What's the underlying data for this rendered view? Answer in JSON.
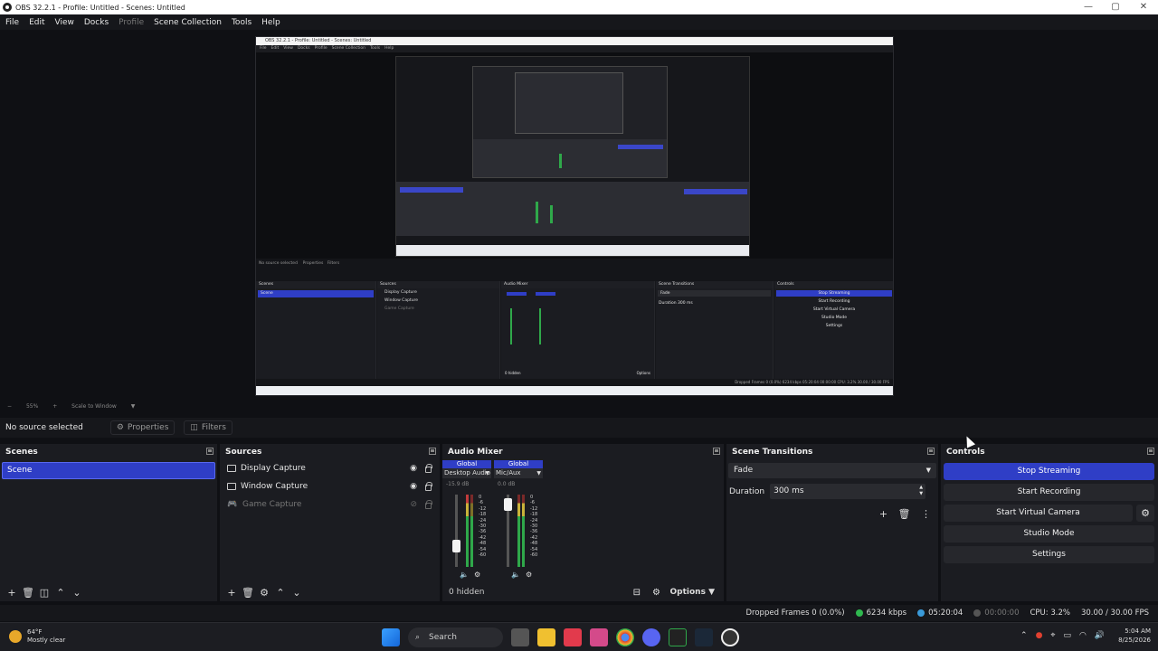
{
  "window": {
    "title": "OBS 32.2.1 - Profile: Untitled - Scenes: Untitled",
    "minimize": "—",
    "maximize": "▢",
    "close": "✕"
  },
  "menu": [
    "File",
    "Edit",
    "View",
    "Docks",
    "Profile",
    "Scene Collection",
    "Tools",
    "Help"
  ],
  "nested_preview": {
    "title": "OBS 32.2.1 - Profile: Untitled - Scenes: Untitled",
    "menu": [
      "File",
      "Edit",
      "View",
      "Docks",
      "Profile",
      "Scene Collection",
      "Tools",
      "Help"
    ],
    "no_source": "No source selected",
    "properties": "Properties",
    "filters": "Filters",
    "scenes": "Scenes",
    "scene": "Scene",
    "sources": "Sources",
    "src1": "Display Capture",
    "src2": "Window Capture",
    "src3": "Game Capture",
    "mixer": "Audio Mixer",
    "transitions": "Scene Transitions",
    "fade": "Fade",
    "duration": "Duration",
    "duration_val": "300 ms",
    "controls": "Controls",
    "stop_streaming": "Stop Streaming",
    "start_recording": "Start Recording",
    "start_virtual": "Start Virtual Camera",
    "studio": "Studio Mode",
    "settings": "Settings",
    "hidden": "0 hidden",
    "options": "Options",
    "status": "Dropped Frames 0 (0.0%)   6234 kbps   05:20:04   00:00:00   CPU: 3.2%   30.00 / 30.00 FPS"
  },
  "zoom": {
    "percent": "55%",
    "mode": "Scale to Window"
  },
  "source_bar": {
    "no_source": "No source selected",
    "properties": "Properties",
    "filters": "Filters"
  },
  "scenes": {
    "title": "Scenes",
    "items": [
      "Scene"
    ]
  },
  "sources": {
    "title": "Sources",
    "items": [
      {
        "name": "Display Capture"
      },
      {
        "name": "Window Capture"
      },
      {
        "name": "Game Capture"
      }
    ]
  },
  "mixer": {
    "title": "Audio Mixer",
    "channels": [
      {
        "tag": "Global",
        "name": "Desktop Audio",
        "db": "-15.9 dB",
        "level": 0.3
      },
      {
        "tag": "Global",
        "name": "Mic/Aux",
        "db": "0.0 dB",
        "level": 0.95
      }
    ],
    "scale": [
      "0",
      "-6",
      "-12",
      "-18",
      "-24",
      "-30",
      "-36",
      "-42",
      "-48",
      "-54",
      "-60"
    ],
    "hidden": "0 hidden",
    "options": "Options"
  },
  "transitions": {
    "title": "Scene Transitions",
    "selected": "Fade",
    "duration_label": "Duration",
    "duration_value": "300 ms"
  },
  "controls": {
    "title": "Controls",
    "stop_streaming": "Stop Streaming",
    "start_recording": "Start Recording",
    "start_virtual_camera": "Start Virtual Camera",
    "studio_mode": "Studio Mode",
    "settings": "Settings"
  },
  "status": {
    "dropped": "Dropped Frames 0 (0.0%)",
    "bitrate": "6234 kbps",
    "stream_time": "05:20:04",
    "rec_time": "00:00:00",
    "cpu": "CPU: 3.2%",
    "fps": "30.00 / 30.00 FPS",
    "colors": {
      "good": "#2fb84f",
      "live": "#3a9ad9"
    }
  },
  "taskbar": {
    "temp": "64°F",
    "weather": "Mostly clear",
    "search": "Search",
    "time": "5:04 AM",
    "date": "8/25/2026"
  }
}
